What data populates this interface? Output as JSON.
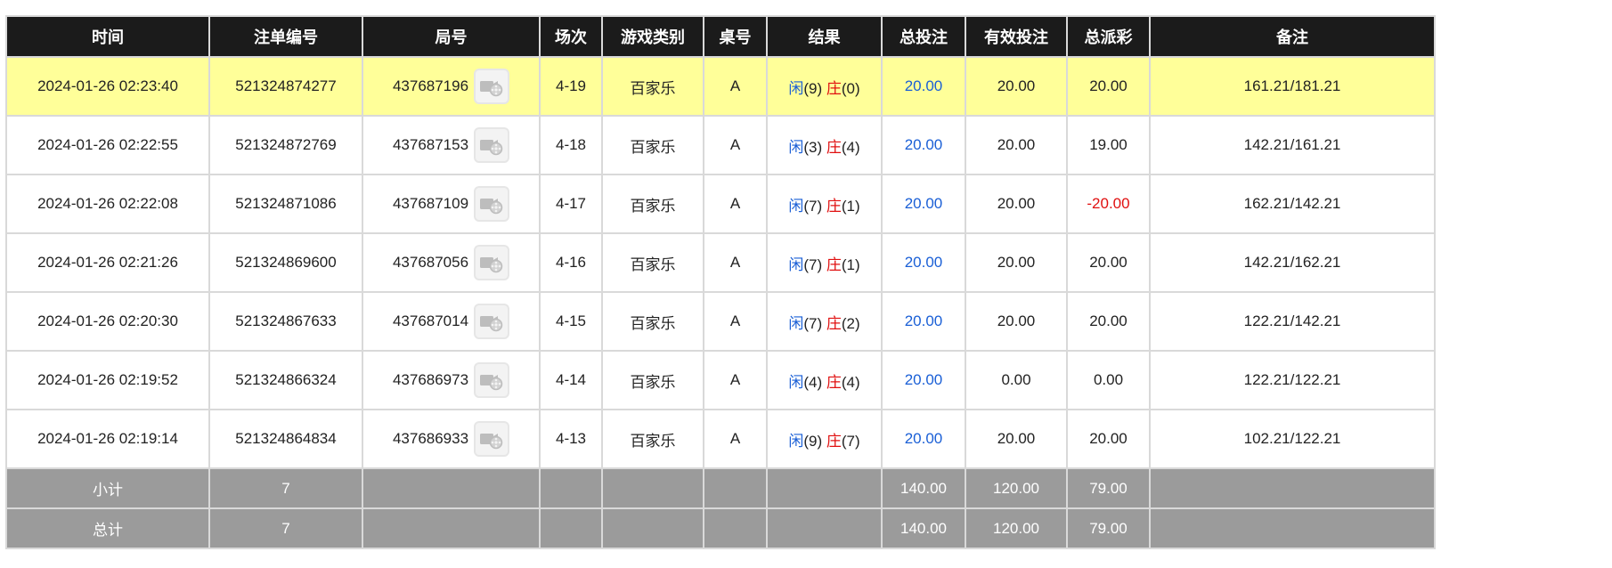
{
  "headers": [
    "时间",
    "注单编号",
    "局号",
    "场次",
    "游戏类别",
    "桌号",
    "结果",
    "总投注",
    "有效投注",
    "总派彩",
    "备注"
  ],
  "rows": [
    {
      "time": "2024-01-26 02:23:40",
      "order": "521324874277",
      "round": "437687196",
      "session": "4-19",
      "game": "百家乐",
      "table": "A",
      "player_label": "闲",
      "player_score": "(9)",
      "banker_label": "庄",
      "banker_score": "(0)",
      "bet": "20.00",
      "valid": "20.00",
      "payout": "20.00",
      "note": "161.21/181.21"
    },
    {
      "time": "2024-01-26 02:22:55",
      "order": "521324872769",
      "round": "437687153",
      "session": "4-18",
      "game": "百家乐",
      "table": "A",
      "player_label": "闲",
      "player_score": "(3)",
      "banker_label": "庄",
      "banker_score": "(4)",
      "bet": "20.00",
      "valid": "20.00",
      "payout": "19.00",
      "note": "142.21/161.21"
    },
    {
      "time": "2024-01-26 02:22:08",
      "order": "521324871086",
      "round": "437687109",
      "session": "4-17",
      "game": "百家乐",
      "table": "A",
      "player_label": "闲",
      "player_score": "(7)",
      "banker_label": "庄",
      "banker_score": "(1)",
      "bet": "20.00",
      "valid": "20.00",
      "payout": "-20.00",
      "note": "162.21/142.21"
    },
    {
      "time": "2024-01-26 02:21:26",
      "order": "521324869600",
      "round": "437687056",
      "session": "4-16",
      "game": "百家乐",
      "table": "A",
      "player_label": "闲",
      "player_score": "(7)",
      "banker_label": "庄",
      "banker_score": "(1)",
      "bet": "20.00",
      "valid": "20.00",
      "payout": "20.00",
      "note": "142.21/162.21"
    },
    {
      "time": "2024-01-26 02:20:30",
      "order": "521324867633",
      "round": "437687014",
      "session": "4-15",
      "game": "百家乐",
      "table": "A",
      "player_label": "闲",
      "player_score": "(7)",
      "banker_label": "庄",
      "banker_score": "(2)",
      "bet": "20.00",
      "valid": "20.00",
      "payout": "20.00",
      "note": "122.21/142.21"
    },
    {
      "time": "2024-01-26 02:19:52",
      "order": "521324866324",
      "round": "437686973",
      "session": "4-14",
      "game": "百家乐",
      "table": "A",
      "player_label": "闲",
      "player_score": "(4)",
      "banker_label": "庄",
      "banker_score": "(4)",
      "bet": "20.00",
      "valid": "0.00",
      "payout": "0.00",
      "note": "122.21/122.21"
    },
    {
      "time": "2024-01-26 02:19:14",
      "order": "521324864834",
      "round": "437686933",
      "session": "4-13",
      "game": "百家乐",
      "table": "A",
      "player_label": "闲",
      "player_score": "(9)",
      "banker_label": "庄",
      "banker_score": "(7)",
      "bet": "20.00",
      "valid": "20.00",
      "payout": "20.00",
      "note": "102.21/122.21"
    }
  ],
  "subtotal": {
    "label": "小计",
    "count": "7",
    "bet": "140.00",
    "valid": "120.00",
    "payout": "79.00"
  },
  "total": {
    "label": "总计",
    "count": "7",
    "bet": "140.00",
    "valid": "120.00",
    "payout": "79.00"
  },
  "colors": {
    "header_bg": "#1b1b1b",
    "highlight_row": "#ffff99",
    "footer_bg": "#9b9b9b",
    "bet_blue": "#1a5fd6",
    "negative_red": "#e01010"
  },
  "icons": {
    "replay": "film-reel-icon"
  }
}
